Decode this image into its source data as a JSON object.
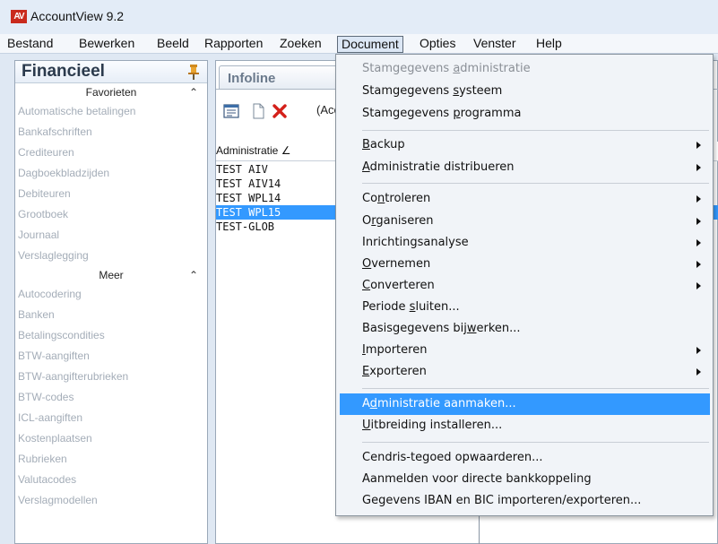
{
  "window": {
    "title": "AccountView 9.2",
    "icon_text": "AV"
  },
  "menubar": [
    "Bestand",
    "Bewerken",
    "Beeld",
    "Rapporten",
    "Zoeken",
    "Document",
    "Opties",
    "Venster",
    "Help"
  ],
  "left_panel": {
    "title": "Financieel",
    "favorites_header": "Favorieten",
    "favorites": [
      "Automatische betalingen",
      "Bankafschriften",
      "Crediteuren",
      "Dagboekbladzijden",
      "Debiteuren",
      "Grootboek",
      "Journaal",
      "Verslaglegging"
    ],
    "more_header": "Meer",
    "more": [
      "Autocodering",
      "Banken",
      "Betalingscondities",
      "BTW-aangiften",
      "BTW-aangifterubrieken",
      "BTW-codes",
      "ICL-aangiften",
      "Kostenplaatsen",
      "Rubrieken",
      "Valutacodes",
      "Verslagmodellen"
    ]
  },
  "right_panel": {
    "tab_label": "Infoline",
    "toolbar_text": "(Acc",
    "column_header": "Administratie ∠",
    "rows": [
      "TEST AIV",
      "TEST AIV14",
      "TEST WPL14",
      "TEST WPL15",
      "TEST-GLOB"
    ],
    "selected_row": "TEST WPL15"
  },
  "document_menu": {
    "items": [
      {
        "pre": "Stamgegevens ",
        "u": "a",
        "post": "dministratie",
        "disabled": true
      },
      {
        "pre": "Stamgegevens ",
        "u": "s",
        "post": "ysteem"
      },
      {
        "pre": "Stamgegevens ",
        "u": "p",
        "post": "rogramma"
      },
      {
        "pre": "",
        "u": "B",
        "post": "ackup",
        "submenu": true
      },
      {
        "pre": "",
        "u": "A",
        "post": "dministratie distribueren",
        "submenu": true
      },
      {
        "pre": "Co",
        "u": "n",
        "post": "troleren",
        "submenu": true
      },
      {
        "pre": "O",
        "u": "r",
        "post": "ganiseren",
        "submenu": true
      },
      {
        "pre": "Inrichtingsanalyse",
        "u": "",
        "post": "",
        "submenu": true
      },
      {
        "pre": "",
        "u": "O",
        "post": "vernemen",
        "submenu": true
      },
      {
        "pre": "",
        "u": "C",
        "post": "onverteren",
        "submenu": true
      },
      {
        "pre": "Periode ",
        "u": "s",
        "post": "luiten..."
      },
      {
        "pre": "Basisgegevens bij",
        "u": "w",
        "post": "erken..."
      },
      {
        "pre": "",
        "u": "I",
        "post": "mporteren",
        "submenu": true
      },
      {
        "pre": "",
        "u": "E",
        "post": "xporteren",
        "submenu": true
      },
      {
        "pre": "A",
        "u": "d",
        "post": "ministratie aanmaken...",
        "highlighted": true
      },
      {
        "pre": "",
        "u": "U",
        "post": "itbreiding installeren..."
      },
      {
        "pre": "Cendris-tegoed opwaarderen...",
        "u": "",
        "post": ""
      },
      {
        "pre": "Aanmelden voor directe bankkoppeling",
        "u": "",
        "post": ""
      },
      {
        "pre": "Gegevens IBAN en BIC importeren/exporteren...",
        "u": "",
        "post": ""
      }
    ]
  },
  "colors": {
    "selection": "#3399ff",
    "menu_bg": "#f1f4f8",
    "app_icon": "#c92a1d"
  }
}
